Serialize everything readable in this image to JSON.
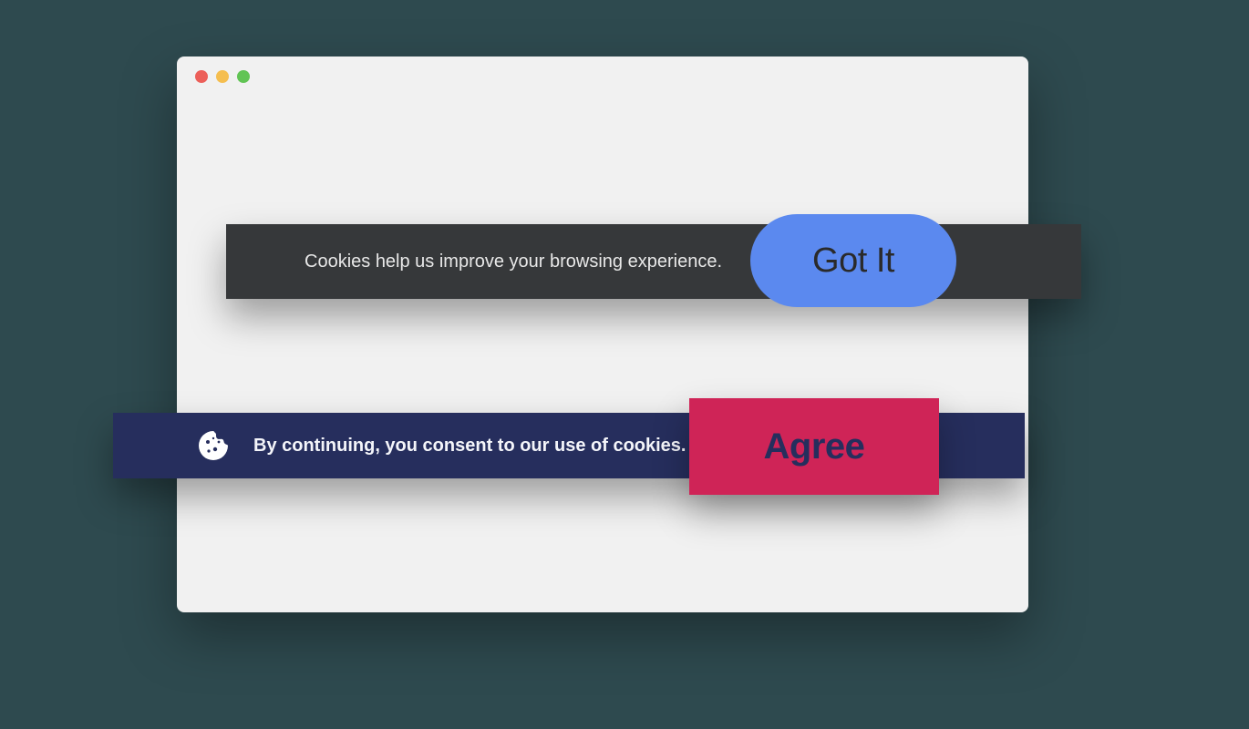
{
  "banner1": {
    "message": "Cookies help us improve your browsing experience.",
    "button_label": "Got It"
  },
  "banner2": {
    "message": "By continuing, you consent to our use of cookies.",
    "button_label": "Agree"
  }
}
